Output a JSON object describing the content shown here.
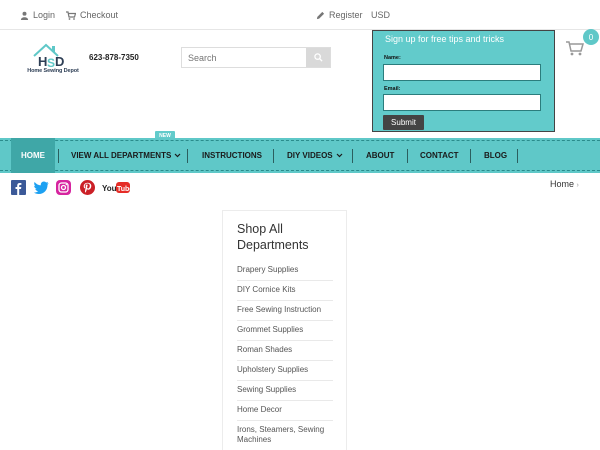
{
  "topbar": {
    "login": "Login",
    "checkout": "Checkout",
    "register": "Register",
    "currency": "USD"
  },
  "header": {
    "logo_text": "Home Sewing Depot",
    "phone": "623-878-7350",
    "search_placeholder": "Search"
  },
  "signup": {
    "title": "Sign up for free tips and tricks",
    "name_label": "Name:",
    "email_label": "Email:",
    "submit_label": "Submit"
  },
  "cart": {
    "count": "0"
  },
  "nav": {
    "new_badge": "NEW",
    "items": [
      {
        "label": "HOME"
      },
      {
        "label": "VIEW ALL DEPARTMENTS"
      },
      {
        "label": "INSTRUCTIONS"
      },
      {
        "label": "DIY VIDEOS"
      },
      {
        "label": "ABOUT"
      },
      {
        "label": "CONTACT"
      },
      {
        "label": "BLOG"
      }
    ]
  },
  "social": {
    "icons": [
      "facebook-icon",
      "twitter-icon",
      "instagram-icon",
      "pinterest-icon",
      "youtube-icon"
    ],
    "youtube_text": "YouTube"
  },
  "breadcrumb": {
    "home": "Home"
  },
  "departments": {
    "title": "Shop All Departments",
    "items": [
      "Drapery Supplies",
      "DIY Cornice Kits",
      "Free Sewing Instruction",
      "Grommet Supplies",
      "Roman Shades",
      "Upholstery Supplies",
      "Sewing Supplies",
      "Home Decor",
      "Irons, Steamers, Sewing Machines"
    ]
  },
  "colors": {
    "accent": "#5fc8c8",
    "accent_dark": "#3fa7a7",
    "signup_bg": "#62cbcb",
    "submit_bg": "#444444"
  }
}
